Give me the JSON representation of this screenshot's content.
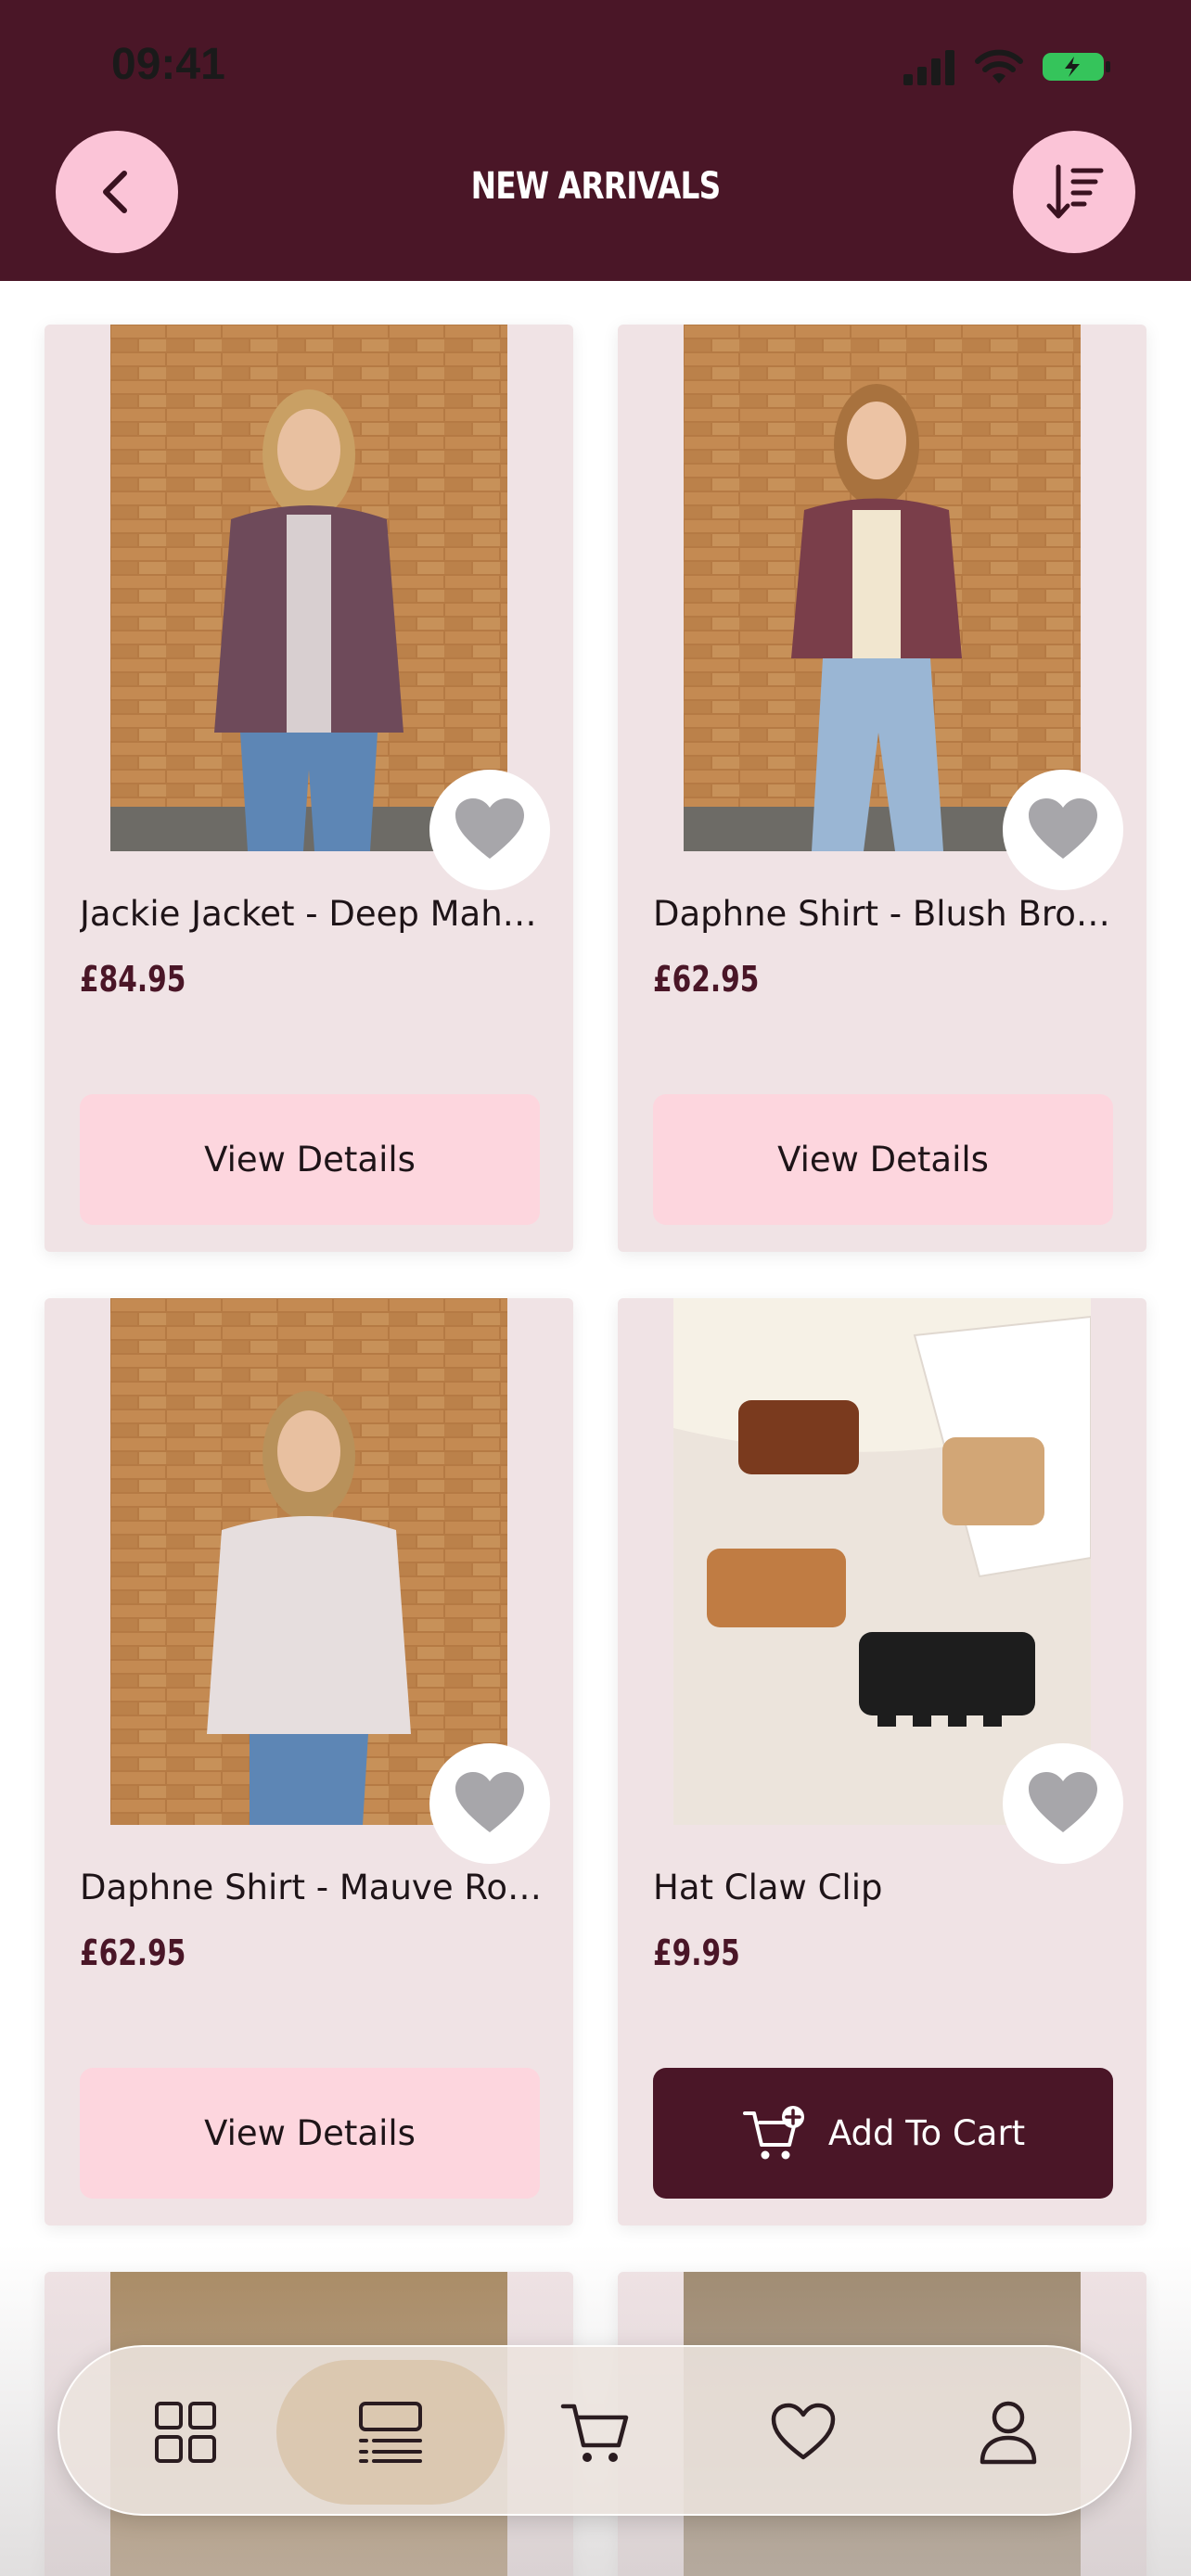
{
  "status_bar": {
    "time": "09:41"
  },
  "header": {
    "title": "NEW ARRIVALS"
  },
  "products": [
    {
      "name": "Jackie Jacket - Deep Mah…",
      "price": "£84.95",
      "cta": "View Details"
    },
    {
      "name": "Daphne Shirt - Blush Brown",
      "price": "£62.95",
      "cta": "View Details"
    },
    {
      "name": "Daphne Shirt - Mauve Ros…",
      "price": "£62.95",
      "cta": "View Details"
    },
    {
      "name": "Hat Claw Clip",
      "price": "£9.95",
      "cta": "Add To Cart"
    }
  ],
  "tab_bar": {
    "items": [
      "grid-icon",
      "list-icon",
      "cart-icon",
      "heart-icon",
      "profile-icon"
    ],
    "active": "list-icon"
  },
  "colors": {
    "brand": "#4a1627",
    "accent_pink": "#fbc4d7",
    "button_pink": "#fdd6de",
    "card_bg": "#f0e3e5"
  }
}
